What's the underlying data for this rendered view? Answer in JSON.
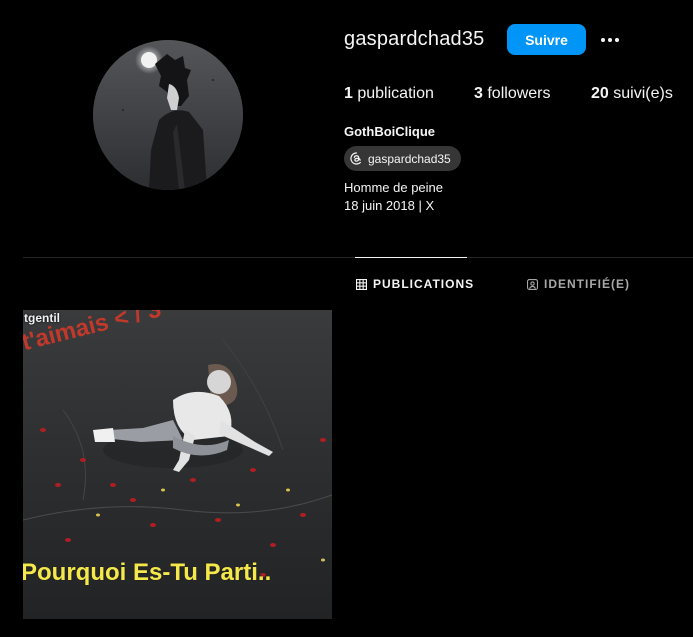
{
  "profile": {
    "username": "gaspardchad35",
    "follow_label": "Suivre",
    "more_label": "•••",
    "full_name": "GothBoiClique",
    "threads_handle": "gaspardchad35",
    "bio_lines": [
      "Homme de peine",
      "18 juin 2018 | X"
    ]
  },
  "stats": {
    "posts_count": "1",
    "posts_label": "publication",
    "followers_count": "3",
    "followers_label": "followers",
    "following_count": "20",
    "following_label": "suivi(e)s"
  },
  "tabs": [
    {
      "label": "PUBLICATIONS",
      "icon": "grid-icon",
      "active": true
    },
    {
      "label": "IDENTIFIÉ(E)",
      "icon": "tagged-icon",
      "active": false
    }
  ],
  "posts": [
    {
      "tag_text": "tgentil",
      "caption_top": "t'aimais < / 3",
      "caption_bottom": "Pourquoi Es-Tu Parti.."
    }
  ],
  "colors": {
    "background": "#000000",
    "accent": "#0095f6",
    "divider": "#262626",
    "muted": "#a8a8a8",
    "chip": "#363636"
  }
}
